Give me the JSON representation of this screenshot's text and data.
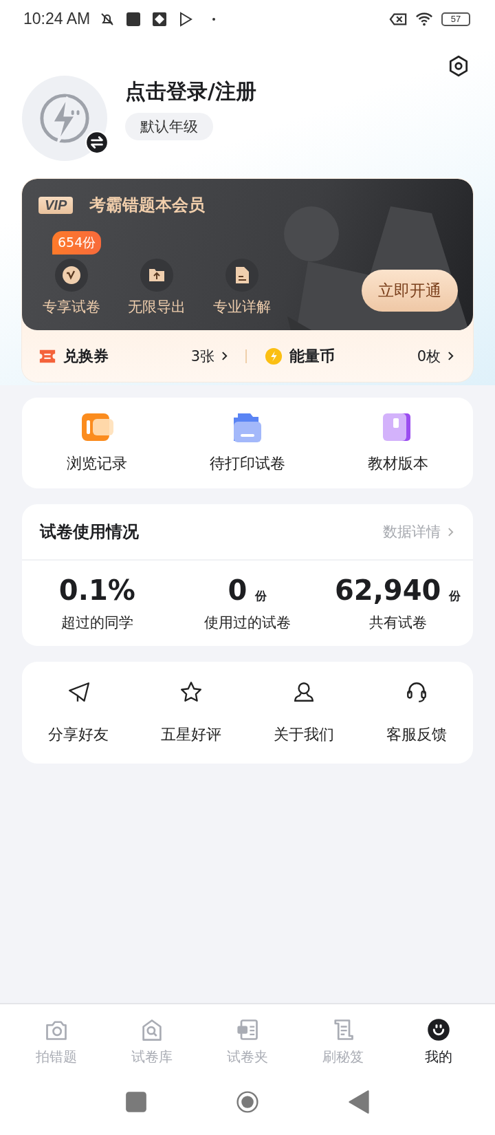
{
  "status_bar": {
    "time": "10:24 AM",
    "battery": "57"
  },
  "profile": {
    "title": "点击登录/注册",
    "grade": "默认年级"
  },
  "vip": {
    "badge": "VIP",
    "title": "考霸错题本会员",
    "count_badge": "654份",
    "features": [
      {
        "label": "专享试卷"
      },
      {
        "label": "无限导出"
      },
      {
        "label": "专业详解"
      }
    ],
    "button": "立即开通"
  },
  "wallet": [
    {
      "label": "兑换券",
      "value": "3张"
    },
    {
      "label": "能量币",
      "value": "0枚"
    }
  ],
  "quick_links": [
    {
      "label": "浏览记录"
    },
    {
      "label": "待打印试卷"
    },
    {
      "label": "教材版本"
    }
  ],
  "usage": {
    "title": "试卷使用情况",
    "link": "数据详情",
    "stats": [
      {
        "value": "0.1%",
        "label": "超过的同学"
      },
      {
        "value": "0",
        "unit": "份",
        "label": "使用过的试卷"
      },
      {
        "value": "62,940",
        "unit": "份",
        "label": "共有试卷"
      }
    ]
  },
  "tools": [
    {
      "label": "分享好友"
    },
    {
      "label": "五星好评"
    },
    {
      "label": "关于我们"
    },
    {
      "label": "客服反馈"
    }
  ],
  "tab_bar": [
    {
      "label": "拍错题",
      "selected": false
    },
    {
      "label": "试卷库",
      "selected": false
    },
    {
      "label": "试卷夹",
      "selected": false
    },
    {
      "label": "刷秘笈",
      "selected": false
    },
    {
      "label": "我的",
      "selected": true
    }
  ]
}
